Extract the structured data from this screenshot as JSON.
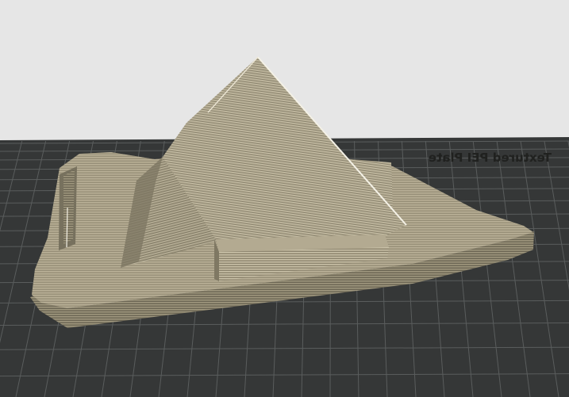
{
  "viewport": {
    "name": "3D slicer layer preview",
    "background_color": "#e6e6e6",
    "bed_color": "#353737",
    "grid_color": "#5a5d5d",
    "bed_label": "Textured PEI Plate",
    "bed_label_mirrored": true
  },
  "model": {
    "name": "pyramid phone stand",
    "filament_color": "#a89f86",
    "edge_highlight_color": "#f4f1e6",
    "shadow_color": "#6f6a58"
  }
}
